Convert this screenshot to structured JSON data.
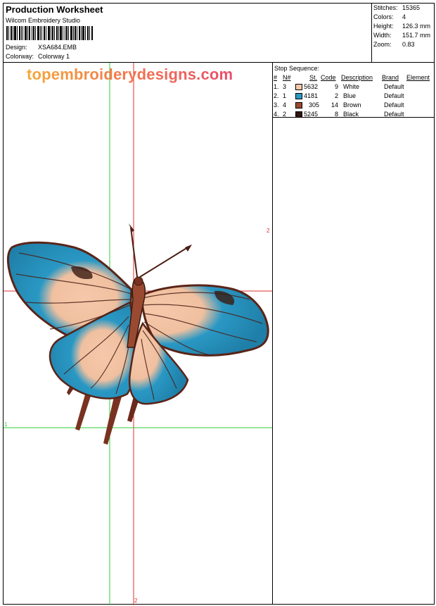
{
  "header": {
    "title": "Production Worksheet",
    "software": "Wilcom Embroidery Studio",
    "design_label": "Design:",
    "design_value": "XSA684.EMB",
    "colorway_label": "Colorway:",
    "colorway_value": "Colorway 1"
  },
  "stats": [
    {
      "label": "Stitches:",
      "value": "15365"
    },
    {
      "label": "Colors:",
      "value": "4"
    },
    {
      "label": "Height:",
      "value": "126.3 mm"
    },
    {
      "label": "Width:",
      "value": "151.7 mm"
    },
    {
      "label": "Zoom:",
      "value": "0.83"
    }
  ],
  "watermark": "topembroiderydesigns.com",
  "stop_sequence": {
    "title": "Stop Sequence:",
    "headers": [
      "#",
      "N#",
      "St.",
      "Code",
      "Description",
      "Brand",
      "Element"
    ],
    "rows": [
      {
        "idx": "1.",
        "n": "3",
        "color": "#f6c8aa",
        "st": "5632",
        "code": "9",
        "desc": "White",
        "brand": "Default"
      },
      {
        "idx": "2.",
        "n": "1",
        "color": "#2a98c4",
        "st": "4181",
        "code": "2",
        "desc": "Blue",
        "brand": "Default"
      },
      {
        "idx": "3.",
        "n": "4",
        "color": "#9a4a30",
        "st": "305",
        "code": "14",
        "desc": "Brown",
        "brand": "Default"
      },
      {
        "idx": "4.",
        "n": "2",
        "color": "#2e1510",
        "st": "5245",
        "code": "8",
        "desc": "Black",
        "brand": "Default"
      }
    ]
  },
  "axis_labels": {
    "red": "2",
    "green": "1"
  },
  "colors": {
    "guide_red": "#e23030",
    "guide_green": "#2ecc3a"
  }
}
